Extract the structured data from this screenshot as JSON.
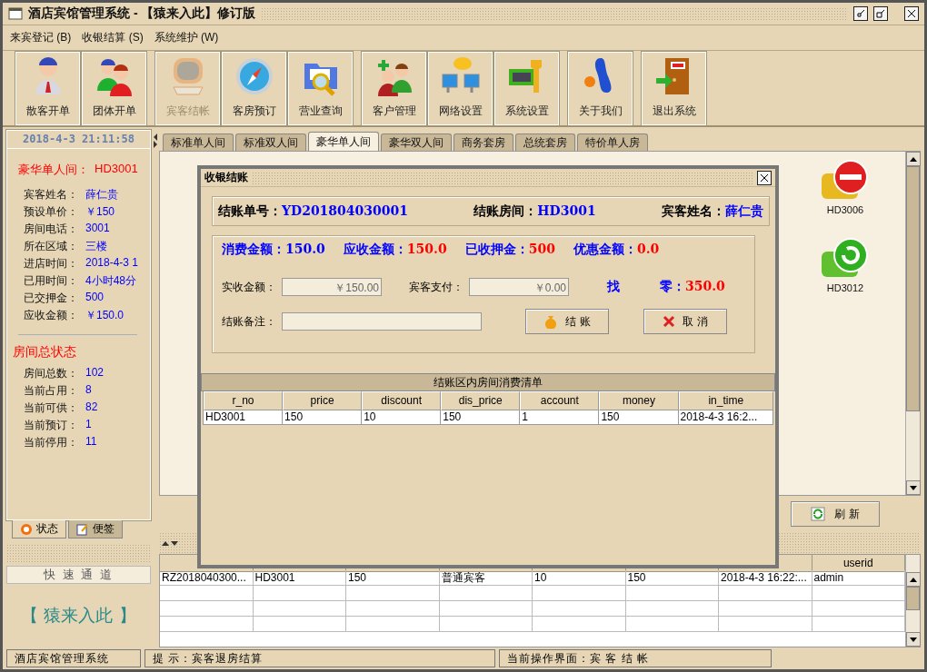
{
  "window": {
    "title": "酒店宾馆管理系统 - 【猿来入此】修订版"
  },
  "menu": [
    "来宾登记 (B)",
    "收银结算 (S)",
    "系统维护 (W)"
  ],
  "toolbar": {
    "groups": [
      [
        {
          "label": "散客开单",
          "disabled": false
        },
        {
          "label": "团体开单",
          "disabled": false
        }
      ],
      [
        {
          "label": "宾客结帐",
          "disabled": true
        },
        {
          "label": "客房预订",
          "disabled": false
        },
        {
          "label": "营业查询",
          "disabled": false
        }
      ],
      [
        {
          "label": "客户管理",
          "disabled": false
        },
        {
          "label": "网络设置",
          "disabled": false
        },
        {
          "label": "系统设置",
          "disabled": false
        }
      ],
      [
        {
          "label": "关于我们",
          "disabled": false
        }
      ],
      [
        {
          "label": "退出系统",
          "disabled": false
        }
      ]
    ]
  },
  "sidebar": {
    "datetime": "2018-4-3  21:11:58",
    "room_heading": {
      "label": "豪华单人间：",
      "value": "HD3001"
    },
    "room_fields": [
      {
        "label": "宾客姓名：",
        "value": "薛仁贵"
      },
      {
        "label": "预设单价：",
        "value": "￥150"
      },
      {
        "label": "房间电话：",
        "value": "3001"
      },
      {
        "label": "所在区域：",
        "value": "三楼"
      },
      {
        "label": "进店时间：",
        "value": "2018-4-3 1"
      },
      {
        "label": "已用时间：",
        "value": "4小时48分"
      },
      {
        "label": "已交押金：",
        "value": "500"
      },
      {
        "label": "应收金额：",
        "value": "￥150.0"
      }
    ],
    "status_heading": "房间总状态",
    "status_fields": [
      {
        "label": "房间总数：",
        "value": "102"
      },
      {
        "label": "当前占用：",
        "value": "8"
      },
      {
        "label": "当前可供：",
        "value": "82"
      },
      {
        "label": "当前预订：",
        "value": "1"
      },
      {
        "label": "当前停用：",
        "value": "11"
      }
    ],
    "tabs": [
      {
        "label": "状态",
        "selected": true
      },
      {
        "label": "便签",
        "selected": false
      }
    ],
    "quick_title": "快 速 通 道",
    "quick_logo": "【 猿来入此 】"
  },
  "room_tabs": [
    {
      "label": "标准单人间",
      "selected": false
    },
    {
      "label": "标准双人间",
      "selected": false
    },
    {
      "label": "豪华单人间",
      "selected": true
    },
    {
      "label": "豪华双人间",
      "selected": false
    },
    {
      "label": "商务套房",
      "selected": false
    },
    {
      "label": "总统套房",
      "selected": false
    },
    {
      "label": "特价单人房",
      "selected": false
    }
  ],
  "rooms": [
    {
      "number": "HD3006",
      "kind": "stopped"
    },
    {
      "number": "HD3012",
      "kind": "free"
    }
  ],
  "refresh_button": "刷 新",
  "bottom_table": {
    "columns": [
      {
        "label": "userid"
      }
    ],
    "rows": [
      [
        "RZ2018040300...",
        "HD3001",
        "150",
        "普通宾客",
        "10",
        "150",
        "2018-4-3 16:22:...",
        "admin"
      ]
    ]
  },
  "dialog": {
    "title": "收银结账",
    "header": [
      {
        "label": "结账单号：",
        "value": "YD201804030001"
      },
      {
        "label": "结账房间：",
        "value": "HD3001"
      },
      {
        "label": "宾客姓名：",
        "value": "薛仁贵"
      }
    ],
    "amounts": [
      {
        "label": "消费金额：",
        "value": "150.0",
        "color": "#0000ff"
      },
      {
        "label": "应收金额：",
        "value": "150.0",
        "color": "#ff0000"
      },
      {
        "label": "已收押金：",
        "value": "500",
        "color": "#ff0000"
      },
      {
        "label": "优惠金额：",
        "value": "0.0",
        "color": "#ff0000"
      }
    ],
    "fields": [
      {
        "label": "实收金额：",
        "value": "￥150.00"
      },
      {
        "label": "宾客支付：",
        "value": "￥0.00"
      }
    ],
    "change": {
      "label_1": "找",
      "label_2": "零：",
      "value": "350.0"
    },
    "note": {
      "label": "结账备注："
    },
    "buttons": [
      {
        "label": "结 账",
        "kind": "confirm"
      },
      {
        "label": "取 消",
        "kind": "cancel"
      }
    ],
    "table": {
      "caption": "结账区内房间消费清单",
      "columns": [
        "r_no",
        "price",
        "discount",
        "dis_price",
        "account",
        "money",
        "in_time"
      ],
      "rows": [
        [
          "HD3001",
          "150",
          "10",
          "150",
          "1",
          "150",
          "2018-4-3 16:2..."
        ]
      ]
    }
  },
  "status_bar": [
    "酒店宾馆管理系统",
    "提 示：宾客退房结算",
    "当前操作界面：宾 客 结 帐"
  ]
}
